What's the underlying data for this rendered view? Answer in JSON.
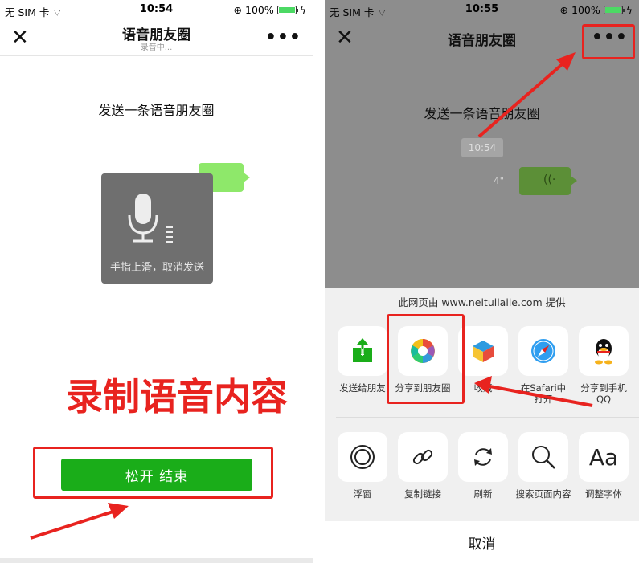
{
  "left": {
    "status": {
      "carrier": "无 SIM 卡",
      "time": "10:54",
      "battery": "100%"
    },
    "nav": {
      "title": "语音朋友圈",
      "subtitle": "录音中..."
    },
    "heading": "发送一条语音朋友圈",
    "recording_hint": "手指上滑，取消发送",
    "annotation": "录制语音内容",
    "release_button": "松开 结束"
  },
  "right": {
    "status": {
      "carrier": "无 SIM 卡",
      "time": "10:55",
      "battery": "100%"
    },
    "nav": {
      "title": "语音朋友圈"
    },
    "heading": "发送一条语音朋友圈",
    "timestamp": "10:54",
    "voice_duration": "4\"",
    "provider": "此网页由 www.neituilaile.com 提供",
    "share_row": [
      {
        "label": "发送给朋友",
        "icon": "share-upload-icon"
      },
      {
        "label": "分享到朋友圈",
        "icon": "moments-icon"
      },
      {
        "label": "收藏",
        "icon": "favorite-cube-icon"
      },
      {
        "label": "在Safari中打开",
        "icon": "safari-icon"
      },
      {
        "label": "分享到手机QQ",
        "icon": "qq-icon"
      }
    ],
    "action_row": [
      {
        "label": "浮窗",
        "icon": "float-window-icon"
      },
      {
        "label": "复制链接",
        "icon": "link-icon"
      },
      {
        "label": "刷新",
        "icon": "refresh-icon"
      },
      {
        "label": "搜索页面内容",
        "icon": "search-icon"
      },
      {
        "label": "调整字体",
        "icon": "font-icon",
        "glyph": "Aa"
      }
    ],
    "cancel": "取消"
  },
  "colors": {
    "accent_red": "#e8231f",
    "wechat_green": "#1aad19",
    "bubble_green": "#8ee86a"
  }
}
